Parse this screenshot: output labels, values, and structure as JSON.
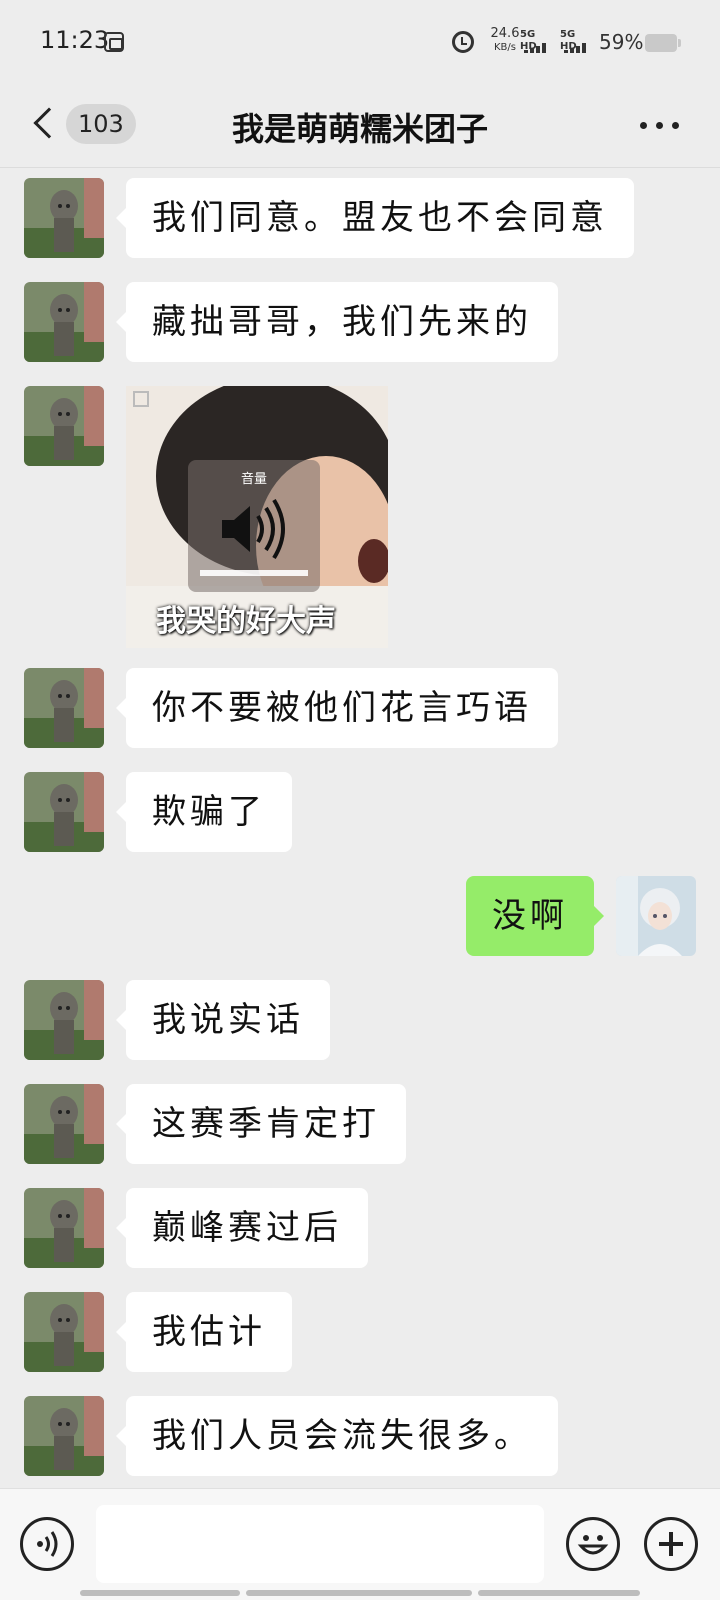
{
  "status_bar": {
    "time": "11:23",
    "net_speed": "24.6",
    "net_speed_unit": "KB/s",
    "signal_1": "5G HD",
    "signal_2": "5G HD",
    "battery": "59%",
    "battery_level": 0.59
  },
  "header": {
    "unread_count": "103",
    "title": "我是萌萌糯米团子"
  },
  "messages": [
    {
      "side": "in",
      "type": "text",
      "text": "我们同意。盟友也不会同意"
    },
    {
      "side": "in",
      "type": "text",
      "text": "藏拙哥哥，我们先来的"
    },
    {
      "side": "in",
      "type": "sticker",
      "caption": "我哭的好大声",
      "overlay_label": "音量"
    },
    {
      "side": "in",
      "type": "text",
      "text": "你不要被他们花言巧语"
    },
    {
      "side": "in",
      "type": "text",
      "text": "欺骗了"
    },
    {
      "side": "out",
      "type": "text",
      "text": "没啊"
    },
    {
      "side": "in",
      "type": "text",
      "text": "我说实话"
    },
    {
      "side": "in",
      "type": "text",
      "text": "这赛季肯定打"
    },
    {
      "side": "in",
      "type": "text",
      "text": "巅峰赛过后"
    },
    {
      "side": "in",
      "type": "text",
      "text": "我估计"
    },
    {
      "side": "in",
      "type": "text",
      "text": "我们人员会流失很多。"
    }
  ],
  "input_bar": {
    "placeholder": "",
    "icons": [
      "voice-icon",
      "emoji-icon",
      "plus-icon"
    ]
  },
  "colors": {
    "background": "#ededed",
    "bubble_in": "#ffffff",
    "bubble_out": "#95ec69"
  }
}
